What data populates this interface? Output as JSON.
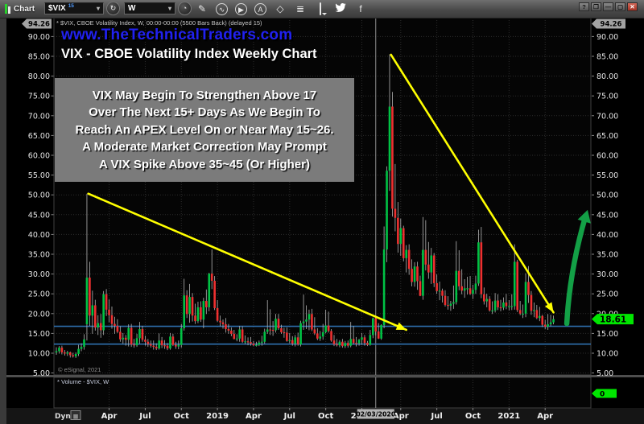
{
  "toolbar": {
    "chart_label": "Chart",
    "symbol": {
      "value": "$VIX",
      "badge": "15"
    },
    "interval": {
      "value": "W"
    },
    "caret_glyph": "▾",
    "symbol_lookup_glyph": "↻",
    "clock_glyph": "◔",
    "tools": [
      {
        "name": "draw-pencil-button",
        "glyph": "✎",
        "circled": false
      },
      {
        "name": "trendline-tools-button",
        "glyph": "∿",
        "circled": true
      },
      {
        "name": "playback-button",
        "glyph": "▶",
        "circled": true
      },
      {
        "name": "text-annotation-button",
        "glyph": "A",
        "circled": true
      },
      {
        "name": "eraser-button",
        "glyph": "◇",
        "circled": false
      },
      {
        "name": "studies-button",
        "glyph": "≣",
        "circled": false
      },
      {
        "name": "chat-button",
        "glyph": "",
        "circled": false,
        "type": "bubble"
      },
      {
        "name": "twitter-button",
        "glyph": "",
        "circled": false,
        "type": "twitter"
      },
      {
        "name": "facebook-button",
        "glyph": "f",
        "circled": false
      }
    ],
    "window_buttons": [
      {
        "name": "help-button",
        "glyph": "?"
      },
      {
        "name": "restore-button",
        "glyph": "❐"
      },
      {
        "name": "minimize-button",
        "glyph": "—"
      },
      {
        "name": "maximize-button",
        "glyph": "▢"
      },
      {
        "name": "close-button",
        "glyph": "✕",
        "close": true
      }
    ]
  },
  "chart_header": {
    "symbol_description": "* $VIX, CBOE Volatility Index, W, 00:00-00:00 (5500 Bars Back) (delayed 15)",
    "website": "www.TheTechnicalTraders.com",
    "title": "VIX - CBOE Volatility Index Weekly Chart"
  },
  "annotation": {
    "lines": [
      "VIX May Begin To Strengthen Above 17",
      "Over The Next 15+ Days As We Begin To",
      "Reach An APEX Level On or Near May 15~26.",
      "A Moderate Market Correction May Prompt",
      "A VIX Spike Above 35~45 (Or Higher)"
    ]
  },
  "chart_footer": {
    "copyright": "© eSignal, 2021"
  },
  "volume_pane": {
    "label": "* Volume - $VIX, W",
    "value": "0"
  },
  "time_axis": {
    "dyn_label": "Dyn"
  },
  "colors": {
    "up": "#00c244",
    "down": "#ee3030",
    "wick": "#b4b4b4",
    "support_line": "#2e6fad",
    "trendline": "#ffff00",
    "projection_arrow": "#13a046",
    "last_price_bg": "#00e600",
    "axis_badge_bg": "#a2a2a2",
    "grid": "#2d2d2d",
    "pane_bg": "#050505",
    "axis_text": "#e6e6e6",
    "marker_line": "#8f8f8f",
    "marker_box_bg": "#b4b4b4"
  },
  "chart_data": {
    "type": "candlestick",
    "title": "VIX - CBOE Volatility Index Weekly Chart",
    "symbol": "$VIX",
    "interval": "W",
    "ylim": [
      4.0,
      94.26
    ],
    "y_axis_max_label": "94.26",
    "y_ticks": [
      90,
      85,
      80,
      75,
      70,
      65,
      60,
      55,
      50,
      45,
      40,
      35,
      30,
      25,
      20,
      15,
      10,
      5
    ],
    "last_price": "18.61",
    "volume_last": "0",
    "x_labels": [
      {
        "label": "Apr",
        "bar": 19
      },
      {
        "label": "Jul",
        "bar": 32
      },
      {
        "label": "Oct",
        "bar": 45
      },
      {
        "label": "2019",
        "bar": 58
      },
      {
        "label": "Apr",
        "bar": 71
      },
      {
        "label": "Jul",
        "bar": 84
      },
      {
        "label": "Oct",
        "bar": 97
      },
      {
        "label": "2020",
        "bar": 110
      },
      {
        "label": "Apr",
        "bar": 124
      },
      {
        "label": "Jul",
        "bar": 137
      },
      {
        "label": "Oct",
        "bar": 150
      },
      {
        "label": "2021",
        "bar": 163
      },
      {
        "label": "Apr",
        "bar": 176
      }
    ],
    "vertical_marker": {
      "label": "02/03/2020",
      "bar": 115
    },
    "support_lines": [
      16.8,
      12.3
    ],
    "trendlines": [
      {
        "from_bar": 11.5,
        "from_price": 50.3,
        "to_bar": 126,
        "to_price": 15.9
      },
      {
        "from_bar": 120.5,
        "from_price": 85.4,
        "to_bar": 179,
        "to_price": 20.3
      }
    ],
    "projection_arrow": {
      "from_bar": 183.8,
      "from_price": 17.5,
      "control_bar": 184.8,
      "control_price": 30.8,
      "to_bar": 190.5,
      "to_price": 44.5,
      "head_bar": 191.3,
      "head_price": 46.2
    },
    "ohlc": [
      [
        10.2,
        11.5,
        9.6,
        10.5
      ],
      [
        10.5,
        11.8,
        9.9,
        11.4
      ],
      [
        11.4,
        11.9,
        9.7,
        10.2
      ],
      [
        10.2,
        10.8,
        9.4,
        9.9
      ],
      [
        9.9,
        10.6,
        9.3,
        10.2
      ],
      [
        10.2,
        10.4,
        8.9,
        9.5
      ],
      [
        9.5,
        10.1,
        8.9,
        9.2
      ],
      [
        9.2,
        10.2,
        8.8,
        9.8
      ],
      [
        9.8,
        12.1,
        9.3,
        11.1
      ],
      [
        11.1,
        12.5,
        10.5,
        11.6
      ],
      [
        11.6,
        14.8,
        10.9,
        13.5
      ],
      [
        17.3,
        50.3,
        13.2,
        29.1
      ],
      [
        29.1,
        33.1,
        16.9,
        19.5
      ],
      [
        19.5,
        25.8,
        14.9,
        22.1
      ],
      [
        22.1,
        23.5,
        15.7,
        16.5
      ],
      [
        16.5,
        19.6,
        14.6,
        17.6
      ],
      [
        17.6,
        19.9,
        13.9,
        15.8
      ],
      [
        15.8,
        25.7,
        14.6,
        24.9
      ],
      [
        24.9,
        26.2,
        19.4,
        21.0
      ],
      [
        21.0,
        23.6,
        17.8,
        19.6
      ],
      [
        19.6,
        21.8,
        16.2,
        17.4
      ],
      [
        17.4,
        19.2,
        14.9,
        16.9
      ],
      [
        16.9,
        18.6,
        15.1,
        15.4
      ],
      [
        15.4,
        16.8,
        12.9,
        13.5
      ],
      [
        13.5,
        15.1,
        12.4,
        13.9
      ],
      [
        13.9,
        14.6,
        11.9,
        13.4
      ],
      [
        13.4,
        17.3,
        11.7,
        16.4
      ],
      [
        16.4,
        17.4,
        11.6,
        12.2
      ],
      [
        12.2,
        13.6,
        11.4,
        12.0
      ],
      [
        12.0,
        14.9,
        11.6,
        13.8
      ],
      [
        13.8,
        17.9,
        12.4,
        16.1
      ],
      [
        16.1,
        16.9,
        12.9,
        13.4
      ],
      [
        13.4,
        14.4,
        11.9,
        12.9
      ],
      [
        12.9,
        13.6,
        11.6,
        12.3
      ],
      [
        12.3,
        13.2,
        11.4,
        11.9
      ],
      [
        11.9,
        13.2,
        10.9,
        11.6
      ],
      [
        11.6,
        12.5,
        10.8,
        11.2
      ],
      [
        11.2,
        15.0,
        10.9,
        13.2
      ],
      [
        13.2,
        14.1,
        11.3,
        12.0
      ],
      [
        12.0,
        13.3,
        11.1,
        11.9
      ],
      [
        11.9,
        12.6,
        10.8,
        11.2
      ],
      [
        11.2,
        15.1,
        10.9,
        14.2
      ],
      [
        14.2,
        14.9,
        11.8,
        12.1
      ],
      [
        12.1,
        12.9,
        11.1,
        11.7
      ],
      [
        11.7,
        13.2,
        11.0,
        12.1
      ],
      [
        12.1,
        17.4,
        11.4,
        16.3
      ],
      [
        16.3,
        28.8,
        15.7,
        24.6
      ],
      [
        24.6,
        25.9,
        18.9,
        19.9
      ],
      [
        19.9,
        27.5,
        17.7,
        24.2
      ],
      [
        24.2,
        25.2,
        18.0,
        19.5
      ],
      [
        19.5,
        22.5,
        17.4,
        18.1
      ],
      [
        18.1,
        23.0,
        17.6,
        21.6
      ],
      [
        21.6,
        23.1,
        17.9,
        18.5
      ],
      [
        18.5,
        24.0,
        16.3,
        23.2
      ],
      [
        23.2,
        26.1,
        19.9,
        21.6
      ],
      [
        21.6,
        30.3,
        20.6,
        30.1
      ],
      [
        30.1,
        36.2,
        26.2,
        28.3
      ],
      [
        28.3,
        29.5,
        20.9,
        21.4
      ],
      [
        21.4,
        23.4,
        17.9,
        18.2
      ],
      [
        18.2,
        19.5,
        16.8,
        17.8
      ],
      [
        17.8,
        18.5,
        16.2,
        17.3
      ],
      [
        17.3,
        18.9,
        15.2,
        16.1
      ],
      [
        16.1,
        17.4,
        14.9,
        15.7
      ],
      [
        15.7,
        16.5,
        14.3,
        14.9
      ],
      [
        14.9,
        15.9,
        13.5,
        13.6
      ],
      [
        13.6,
        14.8,
        13.0,
        13.7
      ],
      [
        13.7,
        16.9,
        12.9,
        16.0
      ],
      [
        16.0,
        16.8,
        12.6,
        12.9
      ],
      [
        12.9,
        14.5,
        12.3,
        13.0
      ],
      [
        13.0,
        14.0,
        12.0,
        12.8
      ],
      [
        12.8,
        14.1,
        11.9,
        12.4
      ],
      [
        12.4,
        13.1,
        11.8,
        12.0
      ],
      [
        12.0,
        12.9,
        11.7,
        12.1
      ],
      [
        12.1,
        13.2,
        11.8,
        12.7
      ],
      [
        12.7,
        14.4,
        11.9,
        12.9
      ],
      [
        12.9,
        16.2,
        12.4,
        15.4
      ],
      [
        15.4,
        23.4,
        14.9,
        16.0
      ],
      [
        16.0,
        21.1,
        14.6,
        15.9
      ],
      [
        15.9,
        18.1,
        14.4,
        15.8
      ],
      [
        15.8,
        19.9,
        15.2,
        18.7
      ],
      [
        18.7,
        19.9,
        15.9,
        16.3
      ],
      [
        16.3,
        17.2,
        14.9,
        15.3
      ],
      [
        15.3,
        16.4,
        13.9,
        15.2
      ],
      [
        15.2,
        16.5,
        12.9,
        13.1
      ],
      [
        13.1,
        15.1,
        12.5,
        13.3
      ],
      [
        13.3,
        14.3,
        11.9,
        12.4
      ],
      [
        12.4,
        14.6,
        11.7,
        14.0
      ],
      [
        14.0,
        15.2,
        11.9,
        12.2
      ],
      [
        12.2,
        18.2,
        11.7,
        17.6
      ],
      [
        17.6,
        24.8,
        15.9,
        18.0
      ],
      [
        18.0,
        22.1,
        16.1,
        18.5
      ],
      [
        18.5,
        21.0,
        15.8,
        19.9
      ],
      [
        19.9,
        21.2,
        15.6,
        16.0
      ],
      [
        16.0,
        19.1,
        14.6,
        15.0
      ],
      [
        15.0,
        16.3,
        13.3,
        13.7
      ],
      [
        13.7,
        15.6,
        13.1,
        14.2
      ],
      [
        14.2,
        17.4,
        13.4,
        15.3
      ],
      [
        15.3,
        21.0,
        15.0,
        17.0
      ],
      [
        17.0,
        20.5,
        15.2,
        15.6
      ],
      [
        15.6,
        16.1,
        12.9,
        13.2
      ],
      [
        13.2,
        14.6,
        11.8,
        12.3
      ],
      [
        12.3,
        13.6,
        11.7,
        12.0
      ],
      [
        12.0,
        13.3,
        11.5,
        12.9
      ],
      [
        12.9,
        13.6,
        11.4,
        11.8
      ],
      [
        11.8,
        13.1,
        11.3,
        12.6
      ],
      [
        12.6,
        13.2,
        11.4,
        11.9
      ],
      [
        11.9,
        17.9,
        11.5,
        13.6
      ],
      [
        13.6,
        16.9,
        12.2,
        12.6
      ],
      [
        12.6,
        14.1,
        11.7,
        12.5
      ],
      [
        12.5,
        13.6,
        11.9,
        13.4
      ],
      [
        13.4,
        15.1,
        12.1,
        14.0
      ],
      [
        14.0,
        14.6,
        11.9,
        12.6
      ],
      [
        12.6,
        13.1,
        11.8,
        12.1
      ],
      [
        12.1,
        15.9,
        11.9,
        14.6
      ],
      [
        14.6,
        19.0,
        13.8,
        18.8
      ],
      [
        18.8,
        19.3,
        14.5,
        15.5
      ],
      [
        15.5,
        17.6,
        13.6,
        13.7
      ],
      [
        13.7,
        17.3,
        13.4,
        17.1
      ],
      [
        17.1,
        42.0,
        16.3,
        36.2
      ],
      [
        36.2,
        57.2,
        33.0,
        56.1
      ],
      [
        56.1,
        85.5,
        51.0,
        72.3
      ],
      [
        72.3,
        76.0,
        44.5,
        46.5
      ],
      [
        46.5,
        57.8,
        40.8,
        44.2
      ],
      [
        44.2,
        48.2,
        35.4,
        37.6
      ],
      [
        37.6,
        44.0,
        34.6,
        41.6
      ],
      [
        41.6,
        42.2,
        33.2,
        34.0
      ],
      [
        34.0,
        37.3,
        30.4,
        36.1
      ],
      [
        36.1,
        37.5,
        29.8,
        31.3
      ],
      [
        31.3,
        33.7,
        26.9,
        28.0
      ],
      [
        28.0,
        33.0,
        26.8,
        31.9
      ],
      [
        31.9,
        33.1,
        26.0,
        28.2
      ],
      [
        28.2,
        29.6,
        24.4,
        24.5
      ],
      [
        24.5,
        44.4,
        23.5,
        36.1
      ],
      [
        36.1,
        43.6,
        30.9,
        32.4
      ],
      [
        32.4,
        38.1,
        28.8,
        30.4
      ],
      [
        30.4,
        36.6,
        27.5,
        34.7
      ],
      [
        34.7,
        35.3,
        26.7,
        27.7
      ],
      [
        27.7,
        29.9,
        25.0,
        25.7
      ],
      [
        25.7,
        28.1,
        23.4,
        25.8
      ],
      [
        25.8,
        26.3,
        22.8,
        24.5
      ],
      [
        24.5,
        25.9,
        21.8,
        22.2
      ],
      [
        22.2,
        24.4,
        21.0,
        22.0
      ],
      [
        22.0,
        23.2,
        20.7,
        22.5
      ],
      [
        22.5,
        27.1,
        21.2,
        22.9
      ],
      [
        22.9,
        38.3,
        22.3,
        30.8
      ],
      [
        30.8,
        36.0,
        25.9,
        26.9
      ],
      [
        26.9,
        31.2,
        24.9,
        25.8
      ],
      [
        25.8,
        28.7,
        24.0,
        26.4
      ],
      [
        26.4,
        29.3,
        24.8,
        26.4
      ],
      [
        26.4,
        29.5,
        24.7,
        25.0
      ],
      [
        25.0,
        27.3,
        23.7,
        26.0
      ],
      [
        26.0,
        29.6,
        25.0,
        27.6
      ],
      [
        27.6,
        41.2,
        27.0,
        38.0
      ],
      [
        38.0,
        41.9,
        23.9,
        24.9
      ],
      [
        24.9,
        26.6,
        22.3,
        23.1
      ],
      [
        23.1,
        25.0,
        21.6,
        23.7
      ],
      [
        23.7,
        24.4,
        20.5,
        20.8
      ],
      [
        20.8,
        23.1,
        19.9,
        20.8
      ],
      [
        20.8,
        25.2,
        20.3,
        23.3
      ],
      [
        23.3,
        24.9,
        20.9,
        21.6
      ],
      [
        21.6,
        23.5,
        20.6,
        21.5
      ],
      [
        21.5,
        24.1,
        20.9,
        22.8
      ],
      [
        22.8,
        25.0,
        21.1,
        21.9
      ],
      [
        21.9,
        23.4,
        20.8,
        21.9
      ],
      [
        21.9,
        24.9,
        20.9,
        21.9
      ],
      [
        21.9,
        37.5,
        21.0,
        33.1
      ],
      [
        33.1,
        33.6,
        20.4,
        20.9
      ],
      [
        20.9,
        23.2,
        19.6,
        20.0
      ],
      [
        20.0,
        22.3,
        18.9,
        20.0
      ],
      [
        20.0,
        30.2,
        19.1,
        28.0
      ],
      [
        28.0,
        32.0,
        22.7,
        24.7
      ],
      [
        24.7,
        25.7,
        19.7,
        20.7
      ],
      [
        20.7,
        22.8,
        19.1,
        20.9
      ],
      [
        20.9,
        22.2,
        18.6,
        18.9
      ],
      [
        18.9,
        21.7,
        18.1,
        19.4
      ],
      [
        19.4,
        19.7,
        16.6,
        17.2
      ],
      [
        17.2,
        18.4,
        16.1,
        16.7
      ],
      [
        16.7,
        19.9,
        15.9,
        17.3
      ],
      [
        17.3,
        19.7,
        16.8,
        17.8
      ],
      [
        17.8,
        19.5,
        17.3,
        18.61
      ]
    ]
  }
}
